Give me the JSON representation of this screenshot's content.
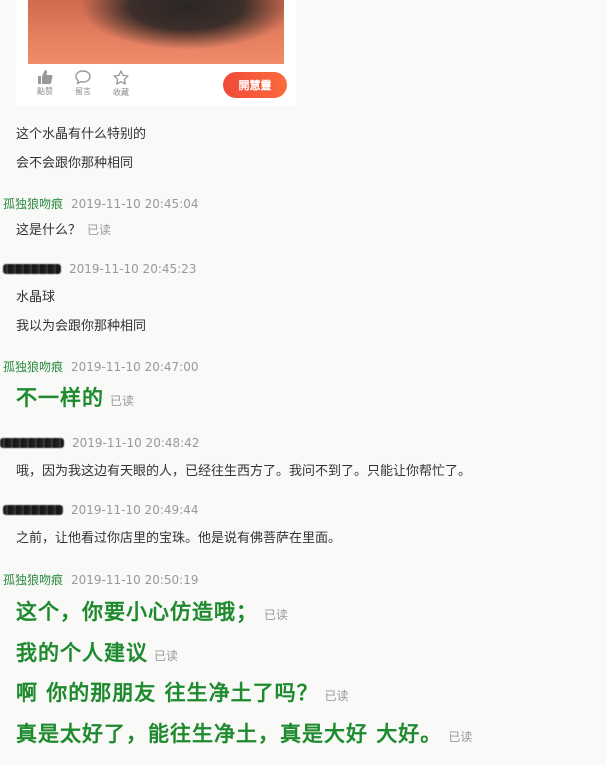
{
  "shared_card": {
    "actions": [
      {
        "icon": "thumbs-up-icon",
        "label": "點赞"
      },
      {
        "icon": "comment-icon",
        "label": "留言"
      },
      {
        "icon": "star-icon",
        "label": "收藏"
      }
    ],
    "button_label": "開慧靈",
    "button_color": "#f04a3a"
  },
  "messages": [
    {
      "id": "m0",
      "lines": [
        "这个水晶有什么特别的",
        "会不会跟你那种相同"
      ]
    },
    {
      "id": "m1",
      "sender": "孤独狼吻痕",
      "time": "2019-11-10 20:45:04",
      "lines": [
        "这是什么？"
      ],
      "read": "已读"
    },
    {
      "id": "m2",
      "time": "2019-11-10 20:45:23",
      "lines": [
        "水晶球",
        "我以为会跟你那种相同"
      ]
    },
    {
      "id": "m3",
      "sender": "孤独狼吻痕",
      "time": "2019-11-10 20:47:00",
      "lines": [
        "不一样的"
      ],
      "read": "已读"
    },
    {
      "id": "m4",
      "time": "2019-11-10 20:48:42",
      "lines": [
        "哦，因为我这边有天眼的人，已经往生西方了。我问不到了。只能让你帮忙了。"
      ]
    },
    {
      "id": "m5",
      "time": "2019-11-10 20:49:44",
      "lines": [
        "之前，让他看过你店里的宝珠。他是说有佛菩萨在里面。"
      ]
    },
    {
      "id": "m6",
      "sender": "孤独狼吻痕",
      "time": "2019-11-10 20:50:19",
      "lines": [
        "这个，你要小心仿造哦；",
        "我的个人建议",
        "啊  你的那朋友  往生净土了吗？",
        "真是太好了，能往生净土，真是大好  大好。"
      ],
      "read": "已读"
    }
  ],
  "colors": {
    "sender_green": "#2b8a3e",
    "big_text_green": "#1e8a2e",
    "read_gray": "#999999"
  }
}
